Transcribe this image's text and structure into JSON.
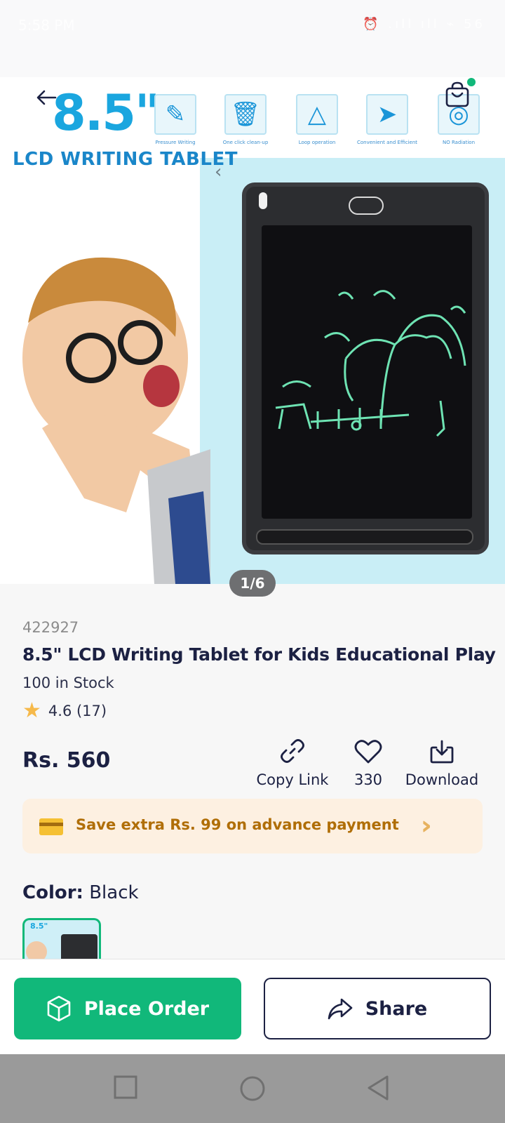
{
  "status_bar": {
    "time": "5:58 PM",
    "icons": "⏰ .ıll ıll ⌁ 56"
  },
  "hero": {
    "big_title": "8.5\"",
    "sub_title": "LCD WRITING TABLET",
    "features": [
      {
        "icon": "pencil-icon",
        "caption": "Pressure Writing",
        "glyph": "✎"
      },
      {
        "icon": "trash-icon",
        "caption": "One click clean-up",
        "glyph": "🗑"
      },
      {
        "icon": "recycle-icon",
        "caption": "Loop operation",
        "glyph": "△"
      },
      {
        "icon": "send-icon",
        "caption": "Convenient and Efficient",
        "glyph": "➤"
      },
      {
        "icon": "eye-icon",
        "caption": "NO Radiation",
        "glyph": "◎"
      }
    ],
    "pager": "1/6"
  },
  "product": {
    "sku": "422927",
    "title": "8.5\" LCD Writing Tablet for Kids Educational Play",
    "stock": "100 in Stock",
    "rating": "4.6 (17)",
    "price": "Rs. 560"
  },
  "actions": {
    "copy_link": "Copy Link",
    "likes": "330",
    "download": "Download"
  },
  "promo": {
    "text": "Save extra Rs. 99 on advance payment"
  },
  "color": {
    "label": "Color:",
    "value": "Black"
  },
  "bottom": {
    "place_order": "Place Order",
    "share": "Share"
  },
  "colors": {
    "accent": "#11b87a",
    "navy": "#1c2143",
    "promo_bg": "#fdf0e1",
    "promo_text": "#b06e07"
  }
}
